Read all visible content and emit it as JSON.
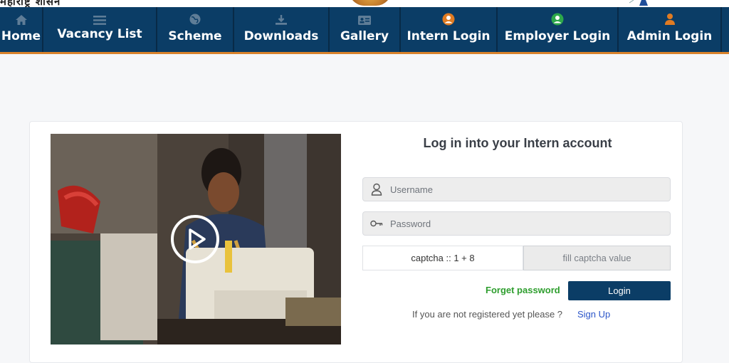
{
  "header": {
    "brand_text": "महाराष्ट्र शासन"
  },
  "nav": {
    "items": [
      {
        "label": "Home",
        "icon": "home-icon"
      },
      {
        "label": "Vacancy List",
        "icon": "list-icon"
      },
      {
        "label": "Scheme",
        "icon": "globe-icon"
      },
      {
        "label": "Downloads",
        "icon": "download-icon"
      },
      {
        "label": "Gallery",
        "icon": "id-card-icon"
      },
      {
        "label": "Intern Login",
        "icon": "user-circle-icon"
      },
      {
        "label": "Employer Login",
        "icon": "user-circle-icon"
      },
      {
        "label": "Admin Login",
        "icon": "user-icon"
      }
    ]
  },
  "login": {
    "title": "Log in into your Intern account",
    "username_placeholder": "Username",
    "password_placeholder": "Password",
    "captcha_text": "captcha :: 1 + 8",
    "captcha_placeholder": "fill captcha value",
    "forget_label": "Forget password",
    "login_label": "Login",
    "register_text": "If you are not registered yet please ?",
    "signup_label": "Sign Up"
  },
  "colors": {
    "nav_bg": "#0b3d66",
    "nav_accent": "#d9822b",
    "forget_green": "#2e9e2e",
    "signup_blue": "#2b55c9"
  }
}
